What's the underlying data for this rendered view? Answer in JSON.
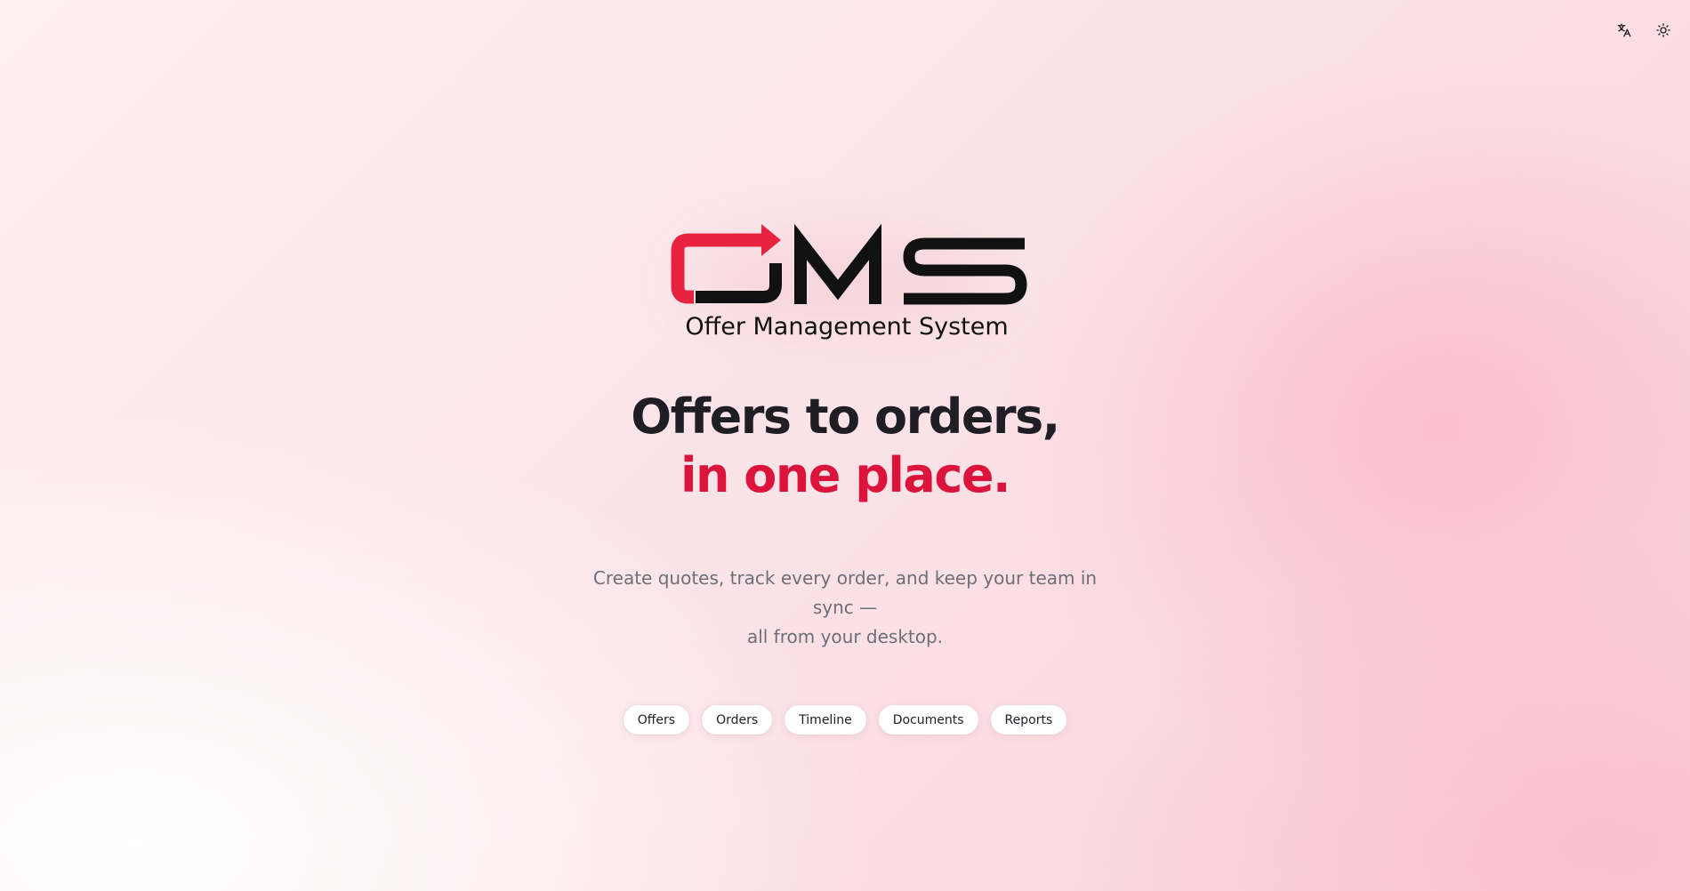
{
  "header": {
    "language_icon": "translate-icon",
    "theme_icon": "sun-icon"
  },
  "logo": {
    "wordmark": "OMS",
    "tagline": "Offer Management System",
    "accent_color": "#e8233f",
    "dark_color": "#111111"
  },
  "hero": {
    "headline_line1": "Offers to orders,",
    "headline_line2": "in one place.",
    "subtitle_line1": "Create quotes, track every order, and keep your team in sync —",
    "subtitle_line2": "all from your desktop."
  },
  "features": [
    {
      "label": "Offers"
    },
    {
      "label": "Orders"
    },
    {
      "label": "Timeline"
    },
    {
      "label": "Documents"
    },
    {
      "label": "Reports"
    }
  ],
  "colors": {
    "accent": "#dc143c",
    "text_dark": "#1e1e24",
    "text_muted": "#6e6e78"
  }
}
